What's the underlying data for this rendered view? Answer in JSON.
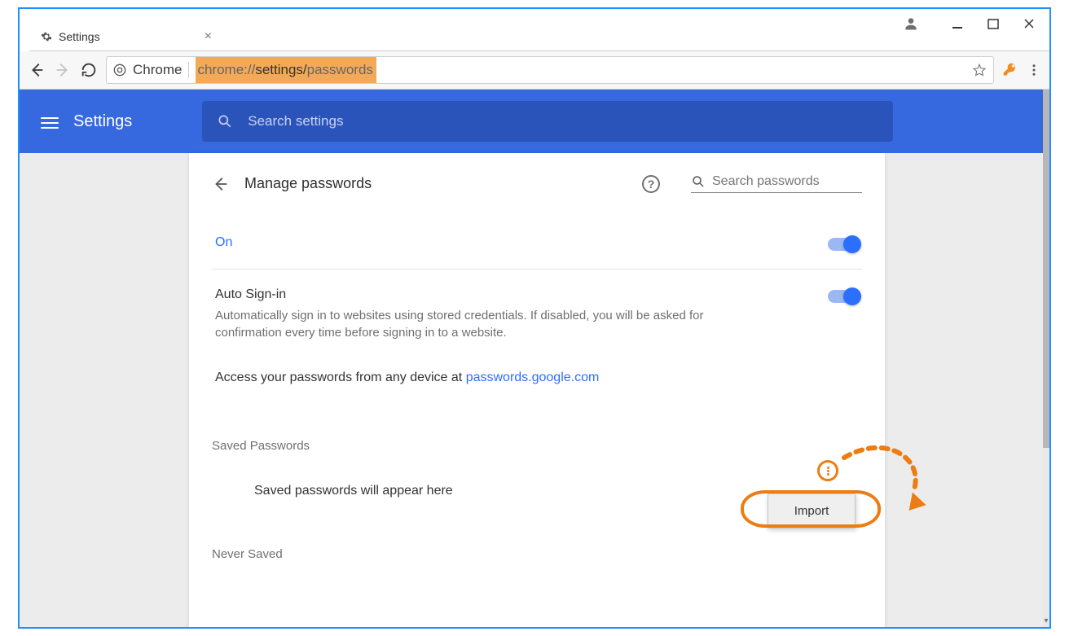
{
  "window": {
    "tab_title": "Settings"
  },
  "toolbar": {
    "chrome_label": "Chrome",
    "url_scheme": "chrome://",
    "url_path1": "settings/",
    "url_path2": "passwords"
  },
  "header": {
    "title": "Settings",
    "search_placeholder": "Search settings"
  },
  "page": {
    "title": "Manage passwords",
    "search_placeholder": "Search passwords",
    "row_on": "On",
    "auto_title": "Auto Sign-in",
    "auto_desc": "Automatically sign in to websites using stored credentials. If disabled, you will be asked for confirmation every time before signing in to a website.",
    "access_prefix": "Access your passwords from any device at ",
    "access_link": "passwords.google.com",
    "saved_header": "Saved Passwords",
    "saved_empty": "Saved passwords will appear here",
    "never_header": "Never Saved",
    "menu_import": "Import"
  }
}
